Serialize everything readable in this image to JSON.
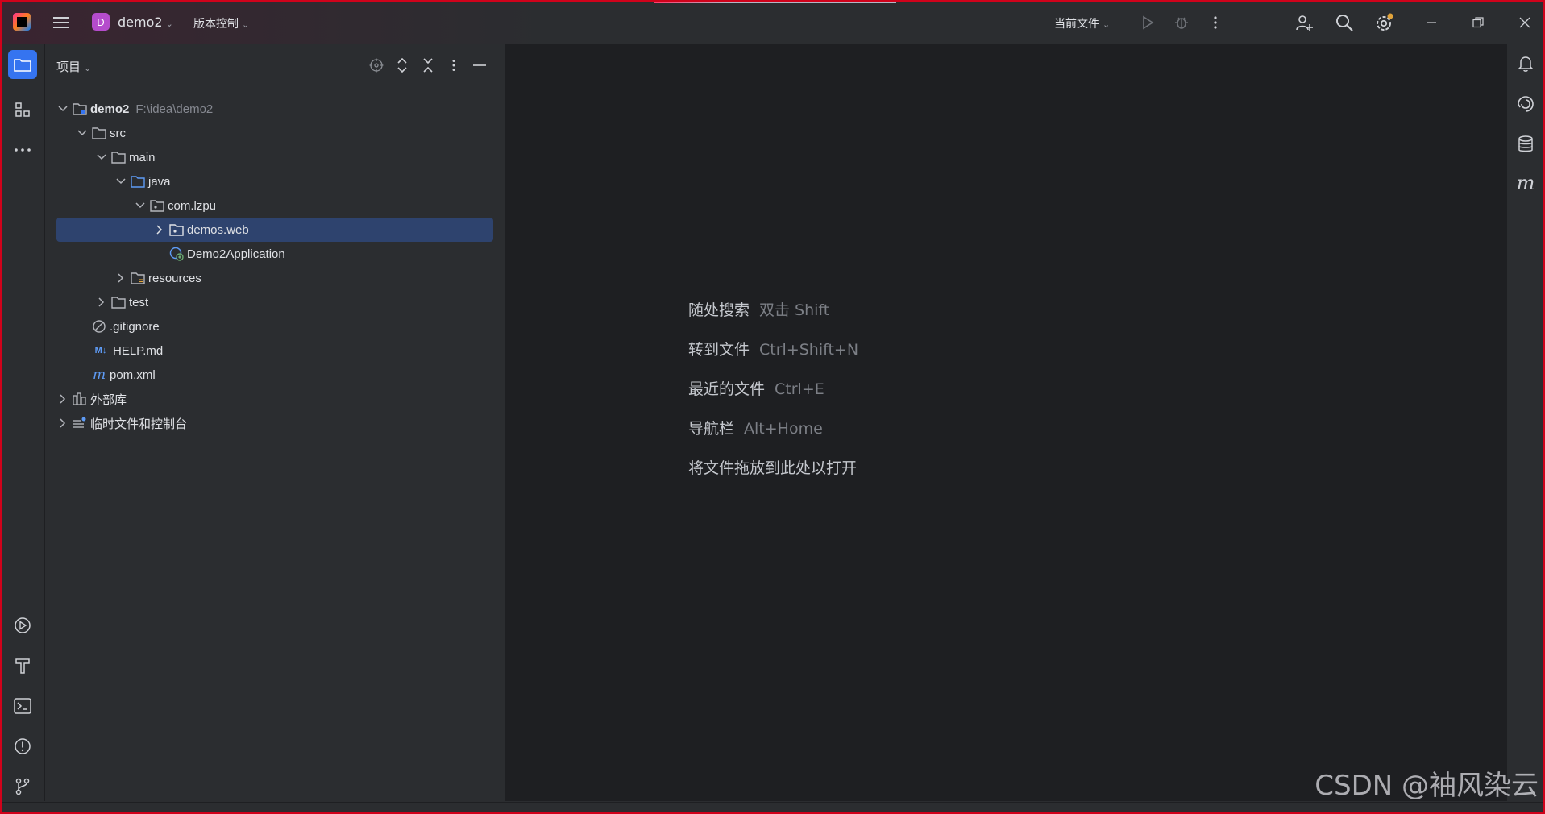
{
  "titlebar": {
    "project_badge": "D",
    "project_name": "demo2",
    "vcs_label": "版本控制",
    "current_file_label": "当前文件"
  },
  "panel": {
    "title": "项目"
  },
  "tree": [
    {
      "label": "demo2",
      "path": "F:\\idea\\demo2"
    },
    {
      "label": "src"
    },
    {
      "label": "main"
    },
    {
      "label": "java"
    },
    {
      "label": "com.lzpu"
    },
    {
      "label": "demos.web"
    },
    {
      "label": "Demo2Application"
    },
    {
      "label": "resources"
    },
    {
      "label": "test"
    },
    {
      "label": ".gitignore"
    },
    {
      "label": "HELP.md"
    },
    {
      "label": "pom.xml"
    },
    {
      "label": "外部库"
    },
    {
      "label": "临时文件和控制台"
    }
  ],
  "editor_hints": [
    {
      "action": "随处搜索",
      "key": "双击 Shift"
    },
    {
      "action": "转到文件",
      "key": "Ctrl+Shift+N"
    },
    {
      "action": "最近的文件",
      "key": "Ctrl+E"
    },
    {
      "action": "导航栏",
      "key": "Alt+Home"
    },
    {
      "action": "将文件拖放到此处以打开",
      "key": ""
    }
  ],
  "icons": {
    "md_badge": "M↓",
    "maven_badge": "m",
    "right_maven_badge": "m"
  },
  "watermark": "CSDN @袖风染云",
  "colors": {
    "accent": "#3574f0",
    "selection": "#2e436e",
    "project_badge": "#b54ccc"
  }
}
